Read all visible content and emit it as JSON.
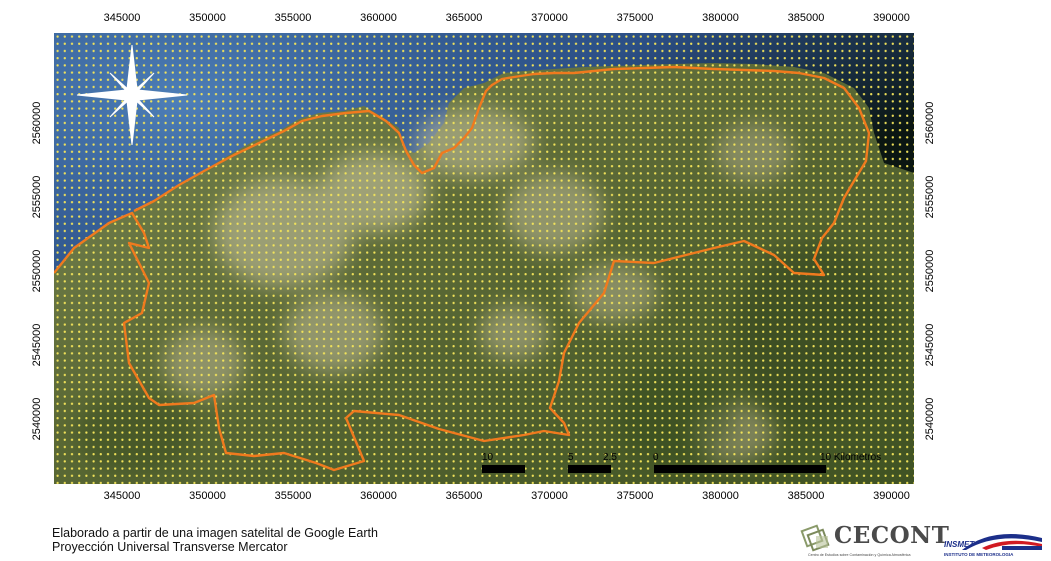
{
  "map": {
    "x_ticks": [
      "345000",
      "350000",
      "355000",
      "360000",
      "365000",
      "370000",
      "375000",
      "380000",
      "385000",
      "390000"
    ],
    "y_ticks": [
      "2560000",
      "2555000",
      "2550000",
      "2545000",
      "2540000"
    ],
    "scale_labels": [
      "10",
      "5",
      "2.5",
      "0",
      "10 Kilometros"
    ],
    "colors": {
      "boundary": "#f07a1e",
      "grid_dots": "#f2e35a",
      "land": "#5b6b34",
      "water_dark": "#0a1410",
      "water_blue": "#2f5c8c"
    },
    "icons": [
      "compass-rose-icon",
      "scale-bar"
    ]
  },
  "credit": {
    "line1": "Elaborado a partir de una imagen satelital de Google Earth",
    "line2": "Proyección Universal Transverse Mercator"
  },
  "logos": {
    "cecont_name": "CECONT",
    "cecont_sub": "Centro de Estudios sobre Contaminación y Química Atmosférica",
    "insmet_name": "INSMET",
    "insmet_sub": "INSTITUTO DE METEOROLOGIA"
  }
}
